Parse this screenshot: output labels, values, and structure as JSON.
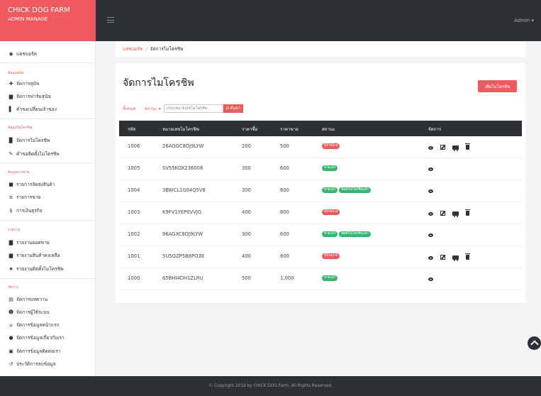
{
  "brand": {
    "title": "CHICK DOG FARM",
    "subtitle": "ADMIN MANAGE"
  },
  "header": {
    "user": "Admin ▾"
  },
  "sidebar": {
    "dashboard": "แดชบอร์ด",
    "sections": [
      {
        "title": "ข้อมูลสุนัข",
        "items": [
          "จัดการสุนัข",
          "จัดการฟาร์มสุนัข",
          "คำขอเปลี่ยนเจ้าของ"
        ]
      },
      {
        "title": "ข้อมูลไมโครชิพ",
        "items": [
          "จัดการไมโครชิพ",
          "คำขอติดตั้งไมโครชิพ"
        ]
      },
      {
        "title": "ข้อมูลการขาย",
        "items": [
          "รายการจัดส่งสินค้า",
          "รายการขาย",
          "การเงินธุรกิจ"
        ]
      },
      {
        "title": "รายงาน",
        "items": [
          "รายงานยอดขาย",
          "รายงานสินค้าคงเหลือ",
          "รายงานติดตั้งไมโครชิพ"
        ]
      },
      {
        "title": "จัดการ",
        "items": [
          "จัดการบทความ",
          "จัดการผู้ใช้ระบบ",
          "จัดการข้อมูลหน้าแรก",
          "จัดการข้อมูลเกี่ยวกับเรา",
          "จัดการข้อมูลติดต่อเรา",
          "ประวัติการลบข้อมูล"
        ]
      }
    ]
  },
  "breadcrumb": {
    "home": "แดชบอร์ด",
    "separator": "/",
    "current": "จัดการไมโครชิพ"
  },
  "page": {
    "title": "จัดการไมโครชิพ",
    "add_button": "เพิ่มไมโครชิพ"
  },
  "filters": {
    "all": "ทั้งหมด",
    "status": "สถานะ ▾",
    "search_placeholder": "กรอกหมายเลขไมโครชิพ",
    "search_button": "Q ค้นหา"
  },
  "table": {
    "columns": [
      "รหัส",
      "หมายเลขไมโครชิพ",
      "ราคาซื้อ",
      "ราคาขาย",
      "สถานะ",
      "จัดการ"
    ],
    "rows": [
      {
        "id": "1006",
        "chip": "26AGGC8OJ9LYW",
        "buy": "200",
        "sell": "500",
        "badges": [
          {
            "text": "มีจำหน่าย",
            "color": "#f05a5e"
          }
        ],
        "actions": [
          "view",
          "edit",
          "ship",
          "delete"
        ]
      },
      {
        "id": "1005",
        "chip": "SV55KOX236008",
        "buy": "300",
        "sell": "600",
        "badges": [
          {
            "text": "ขายแล้ว",
            "color": "#3cb371"
          }
        ],
        "actions": [
          "view"
        ]
      },
      {
        "id": "1004",
        "chip": "3BWCL1G04Q5V8",
        "buy": "300",
        "sell": "600",
        "badges": [
          {
            "text": "ขายแล้ว",
            "color": "#3cb371"
          },
          {
            "text": "ติดตั้งไมโครชิพแล้ว",
            "color": "#3cb371"
          }
        ],
        "actions": [
          "view"
        ]
      },
      {
        "id": "1003",
        "chip": "K9FV1YEP0VVJG",
        "buy": "400",
        "sell": "800",
        "badges": [
          {
            "text": "มีจำหน่าย",
            "color": "#f05a5e"
          }
        ],
        "actions": [
          "view",
          "edit",
          "ship",
          "delete"
        ]
      },
      {
        "id": "1002",
        "chip": "96AGXC8OJ9LYW",
        "buy": "300",
        "sell": "600",
        "badges": [
          {
            "text": "ขายแล้ว",
            "color": "#3cb371"
          },
          {
            "text": "ติดตั้งไมโครชิพแล้ว",
            "color": "#3cb371"
          }
        ],
        "actions": [
          "view"
        ]
      },
      {
        "id": "1001",
        "chip": "5U5QZP5B8PO3E",
        "buy": "400",
        "sell": "800",
        "badges": [
          {
            "text": "มีจำหน่าย",
            "color": "#f05a5e"
          }
        ],
        "actions": [
          "view",
          "edit",
          "ship",
          "delete"
        ]
      },
      {
        "id": "1000",
        "chip": "65BHI4DH1ZLRU",
        "buy": "500",
        "sell": "1,000",
        "badges": [
          {
            "text": "ขายแล้ว",
            "color": "#3cb371"
          }
        ],
        "actions": [
          "view"
        ]
      }
    ]
  },
  "footer": {
    "text": "© Copyright 2019 by CHICK DOG Farm. All Rights Reserved."
  },
  "colors": {
    "accent": "#f05a5e",
    "dark": "#2d3035",
    "success": "#3cb371"
  }
}
